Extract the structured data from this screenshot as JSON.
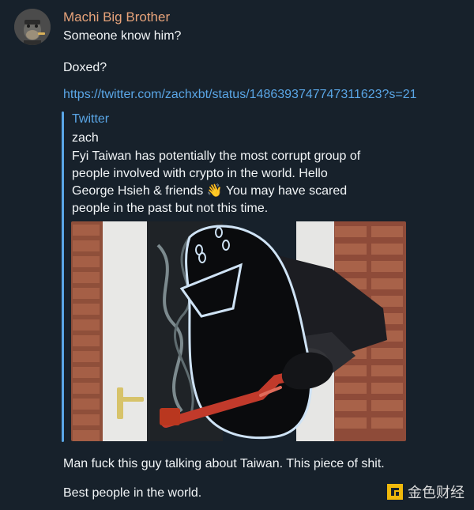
{
  "message": {
    "sender": "Machi Big Brother",
    "lines": {
      "l1": "Someone know him?",
      "l2": "Doxed?",
      "l3": "Man fuck this guy talking about Taiwan. This piece of shit.",
      "l4": "Best people in the world."
    },
    "link": "https://twitter.com/zachxbt/status/1486393747747311623?s=21"
  },
  "embed": {
    "source": "Twitter",
    "author": "zach",
    "text_lines": [
      "Fyi Taiwan has potentially the most corrupt group of",
      "people involved with crypto in the world. Hello",
      "George Hsieh & friends 👋 You may have scared",
      "people in the past but not this time."
    ]
  },
  "watermark": {
    "text": "金色财经"
  },
  "colors": {
    "background": "#17212b",
    "sender": "#e7a37a",
    "link": "#5aa6e6",
    "text": "#f2f5f7",
    "watermark_logo": "#f0b90b"
  },
  "icons": {
    "avatar": "ape-avatar-icon",
    "watermark": "jinse-logo-icon"
  }
}
